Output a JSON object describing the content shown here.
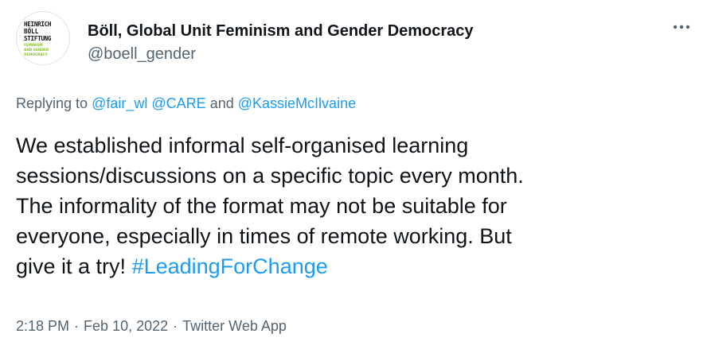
{
  "author": {
    "display_name": "Böll, Global Unit Feminism and Gender Democracy",
    "handle": "@boell_gender",
    "avatar_logo": {
      "line1": "HEINRICH",
      "line2": "BÖLL",
      "line3": "STIFTUNG",
      "sub1": "FEMINISM",
      "sub2": "AND GENDER",
      "sub3": "DEMOCRACY",
      "accent_color": "#8cbf2e"
    }
  },
  "more_icon": "ellipsis-icon",
  "replying": {
    "prefix": "Replying to",
    "mention1": "@fair_wl",
    "mention2": "@CARE",
    "conjunction": "and",
    "mention3": "@KassieMcIlvaine"
  },
  "tweet": {
    "lines": [
      "We established informal self-organised learning",
      "sessions/discussions on a specific topic every month.",
      "The informality of the format may not be suitable for",
      "everyone, especially in times of remote working. But",
      "give it a try!"
    ],
    "hashtag": "#LeadingForChange"
  },
  "meta": {
    "time": "2:18 PM",
    "separator": "·",
    "date": "Feb 10, 2022",
    "source": "Twitter Web App"
  },
  "colors": {
    "link": "#1d9bf0",
    "secondary_text": "#536471",
    "primary_text": "#0f1419"
  }
}
